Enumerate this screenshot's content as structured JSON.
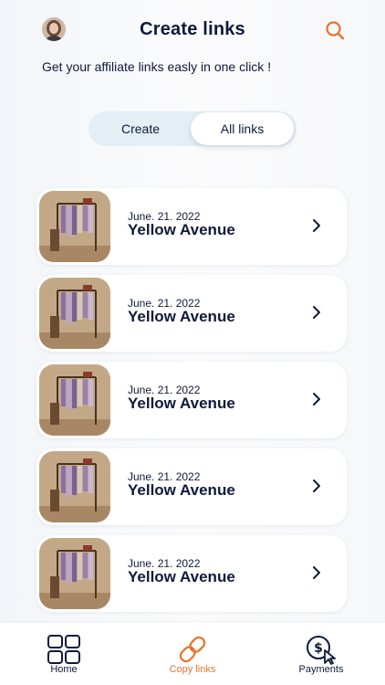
{
  "header": {
    "title": "Create links",
    "subtitle": "Get your affiliate links easly in one click !"
  },
  "tabs": {
    "create_label": "Create",
    "all_links_label": "All links"
  },
  "links": [
    {
      "date": "June. 21. 2022",
      "name": "Yellow Avenue"
    },
    {
      "date": "June. 21. 2022",
      "name": "Yellow Avenue"
    },
    {
      "date": "June. 21. 2022",
      "name": "Yellow Avenue"
    },
    {
      "date": "June. 21. 2022",
      "name": "Yellow Avenue"
    },
    {
      "date": "June. 21. 2022",
      "name": "Yellow Avenue"
    }
  ],
  "nav": {
    "home_label": "Home",
    "copy_label": "Copy links",
    "payments_label": "Payments"
  },
  "colors": {
    "accent": "#e8732a",
    "text": "#0f1a3a",
    "tab_track": "#e3eff5"
  },
  "icons": {
    "search": "search-icon",
    "chevron": "chevron-right-icon",
    "home": "grid-icon",
    "copy": "link-icon",
    "payments": "payment-icon"
  }
}
